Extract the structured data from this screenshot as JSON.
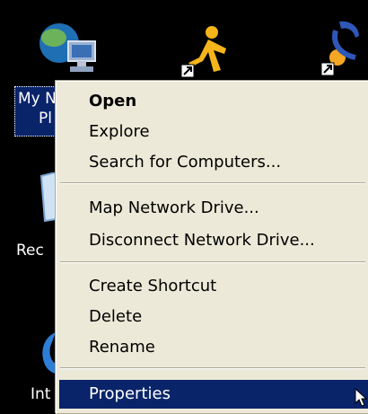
{
  "desktop": {
    "icons": [
      {
        "name": "my-network-places-icon",
        "label_line1": "My N",
        "label_line2": "Pl"
      },
      {
        "name": "aim-shortcut-icon"
      },
      {
        "name": "phone-shortcut-icon"
      },
      {
        "name": "recycle-bin-icon",
        "label": "Rec"
      },
      {
        "name": "internet-explorer-icon",
        "label": "Int"
      }
    ]
  },
  "context_menu": {
    "items": [
      {
        "label": "Open",
        "bold": true
      },
      {
        "label": "Explore"
      },
      {
        "label": "Search for Computers..."
      },
      {
        "label": "Map Network Drive..."
      },
      {
        "label": "Disconnect Network Drive..."
      },
      {
        "label": "Create Shortcut"
      },
      {
        "label": "Delete"
      },
      {
        "label": "Rename"
      },
      {
        "label": "Properties",
        "highlighted": true
      }
    ]
  },
  "colors": {
    "desktop_bg": "#000000",
    "menu_bg": "#ece9d8",
    "highlight": "#0a246a",
    "highlight_text": "#ffffff"
  }
}
